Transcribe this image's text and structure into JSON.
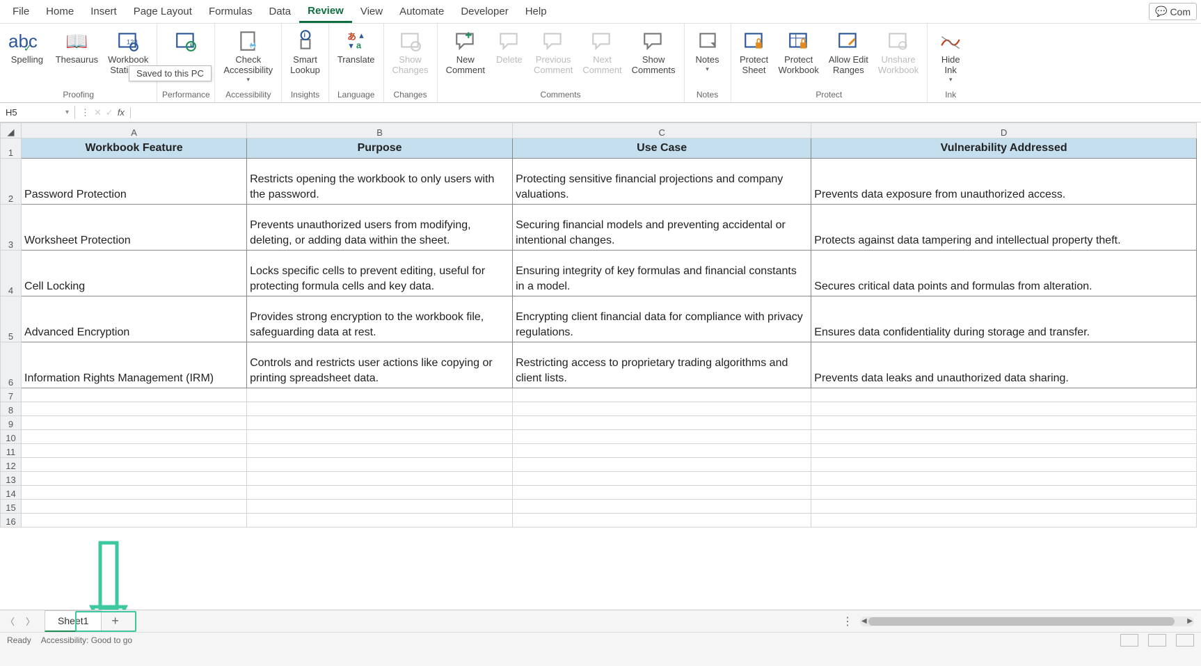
{
  "menu": {
    "tabs": [
      "File",
      "Home",
      "Insert",
      "Page Layout",
      "Formulas",
      "Data",
      "Review",
      "View",
      "Automate",
      "Developer",
      "Help"
    ],
    "active": "Review",
    "comments": "Com"
  },
  "ribbon": {
    "proofing": {
      "label": "Proofing",
      "spelling": "Spelling",
      "thesaurus": "Thesaurus",
      "stats": "Workbook\nStatistics"
    },
    "performance": {
      "label": "Performance"
    },
    "accessibility": {
      "label": "Accessibility",
      "check": "Check\nAccessibility"
    },
    "insights": {
      "label": "Insights",
      "smart": "Smart\nLookup"
    },
    "language": {
      "label": "Language",
      "translate": "Translate"
    },
    "changes": {
      "label": "Changes",
      "show": "Show\nChanges"
    },
    "comments": {
      "label": "Comments",
      "new": "New\nComment",
      "delete": "Delete",
      "prev": "Previous\nComment",
      "next": "Next\nComment",
      "show": "Show\nComments"
    },
    "notes": {
      "label": "Notes",
      "notes": "Notes"
    },
    "protect": {
      "label": "Protect",
      "sheet": "Protect\nSheet",
      "workbook": "Protect\nWorkbook",
      "ranges": "Allow Edit\nRanges",
      "unshare": "Unshare\nWorkbook"
    },
    "ink": {
      "label": "Ink",
      "hide": "Hide\nInk"
    },
    "tooltip": "Saved to this PC"
  },
  "formula_bar": {
    "cell_ref": "H5",
    "fx": "fx",
    "value": ""
  },
  "columns": [
    "A",
    "B",
    "C",
    "D"
  ],
  "headers": {
    "a": "Workbook Feature",
    "b": "Purpose",
    "c": "Use Case",
    "d": "Vulnerability Addressed"
  },
  "rows": [
    {
      "n": "2",
      "a": "Password Protection",
      "b": "Restricts opening the workbook to only users with the password.",
      "c": "Protecting sensitive financial projections and company valuations.",
      "d": "Prevents data exposure from unauthorized access."
    },
    {
      "n": "3",
      "a": "Worksheet Protection",
      "b": "Prevents unauthorized users from modifying, deleting, or adding data within the sheet.",
      "c": "Securing financial models and preventing accidental or intentional changes.",
      "d": "Protects against data tampering and intellectual property theft."
    },
    {
      "n": "4",
      "a": "Cell Locking",
      "b": "Locks specific cells to prevent editing, useful for protecting formula cells and key data.",
      "c": "Ensuring integrity of key formulas and financial constants in a model.",
      "d": "Secures critical data points and formulas from alteration."
    },
    {
      "n": "5",
      "a": "Advanced Encryption",
      "b": "Provides strong encryption to the workbook file, safeguarding data at rest.",
      "c": "Encrypting client financial data for compliance with privacy regulations.",
      "d": "Ensures data confidentiality during storage and transfer."
    },
    {
      "n": "6",
      "a": "Information Rights Management (IRM)",
      "b": "Controls and restricts user actions like copying or printing spreadsheet data.",
      "c": "Restricting access to proprietary trading algorithms and client lists.",
      "d": "Prevents data leaks and unauthorized data sharing."
    }
  ],
  "empty_rows": [
    "7",
    "8",
    "9",
    "10",
    "11",
    "12",
    "13",
    "14",
    "15",
    "16"
  ],
  "sheet": {
    "name": "Sheet1",
    "add": "+"
  },
  "status": {
    "ready": "Ready",
    "access": "Accessibility: Good to go"
  }
}
